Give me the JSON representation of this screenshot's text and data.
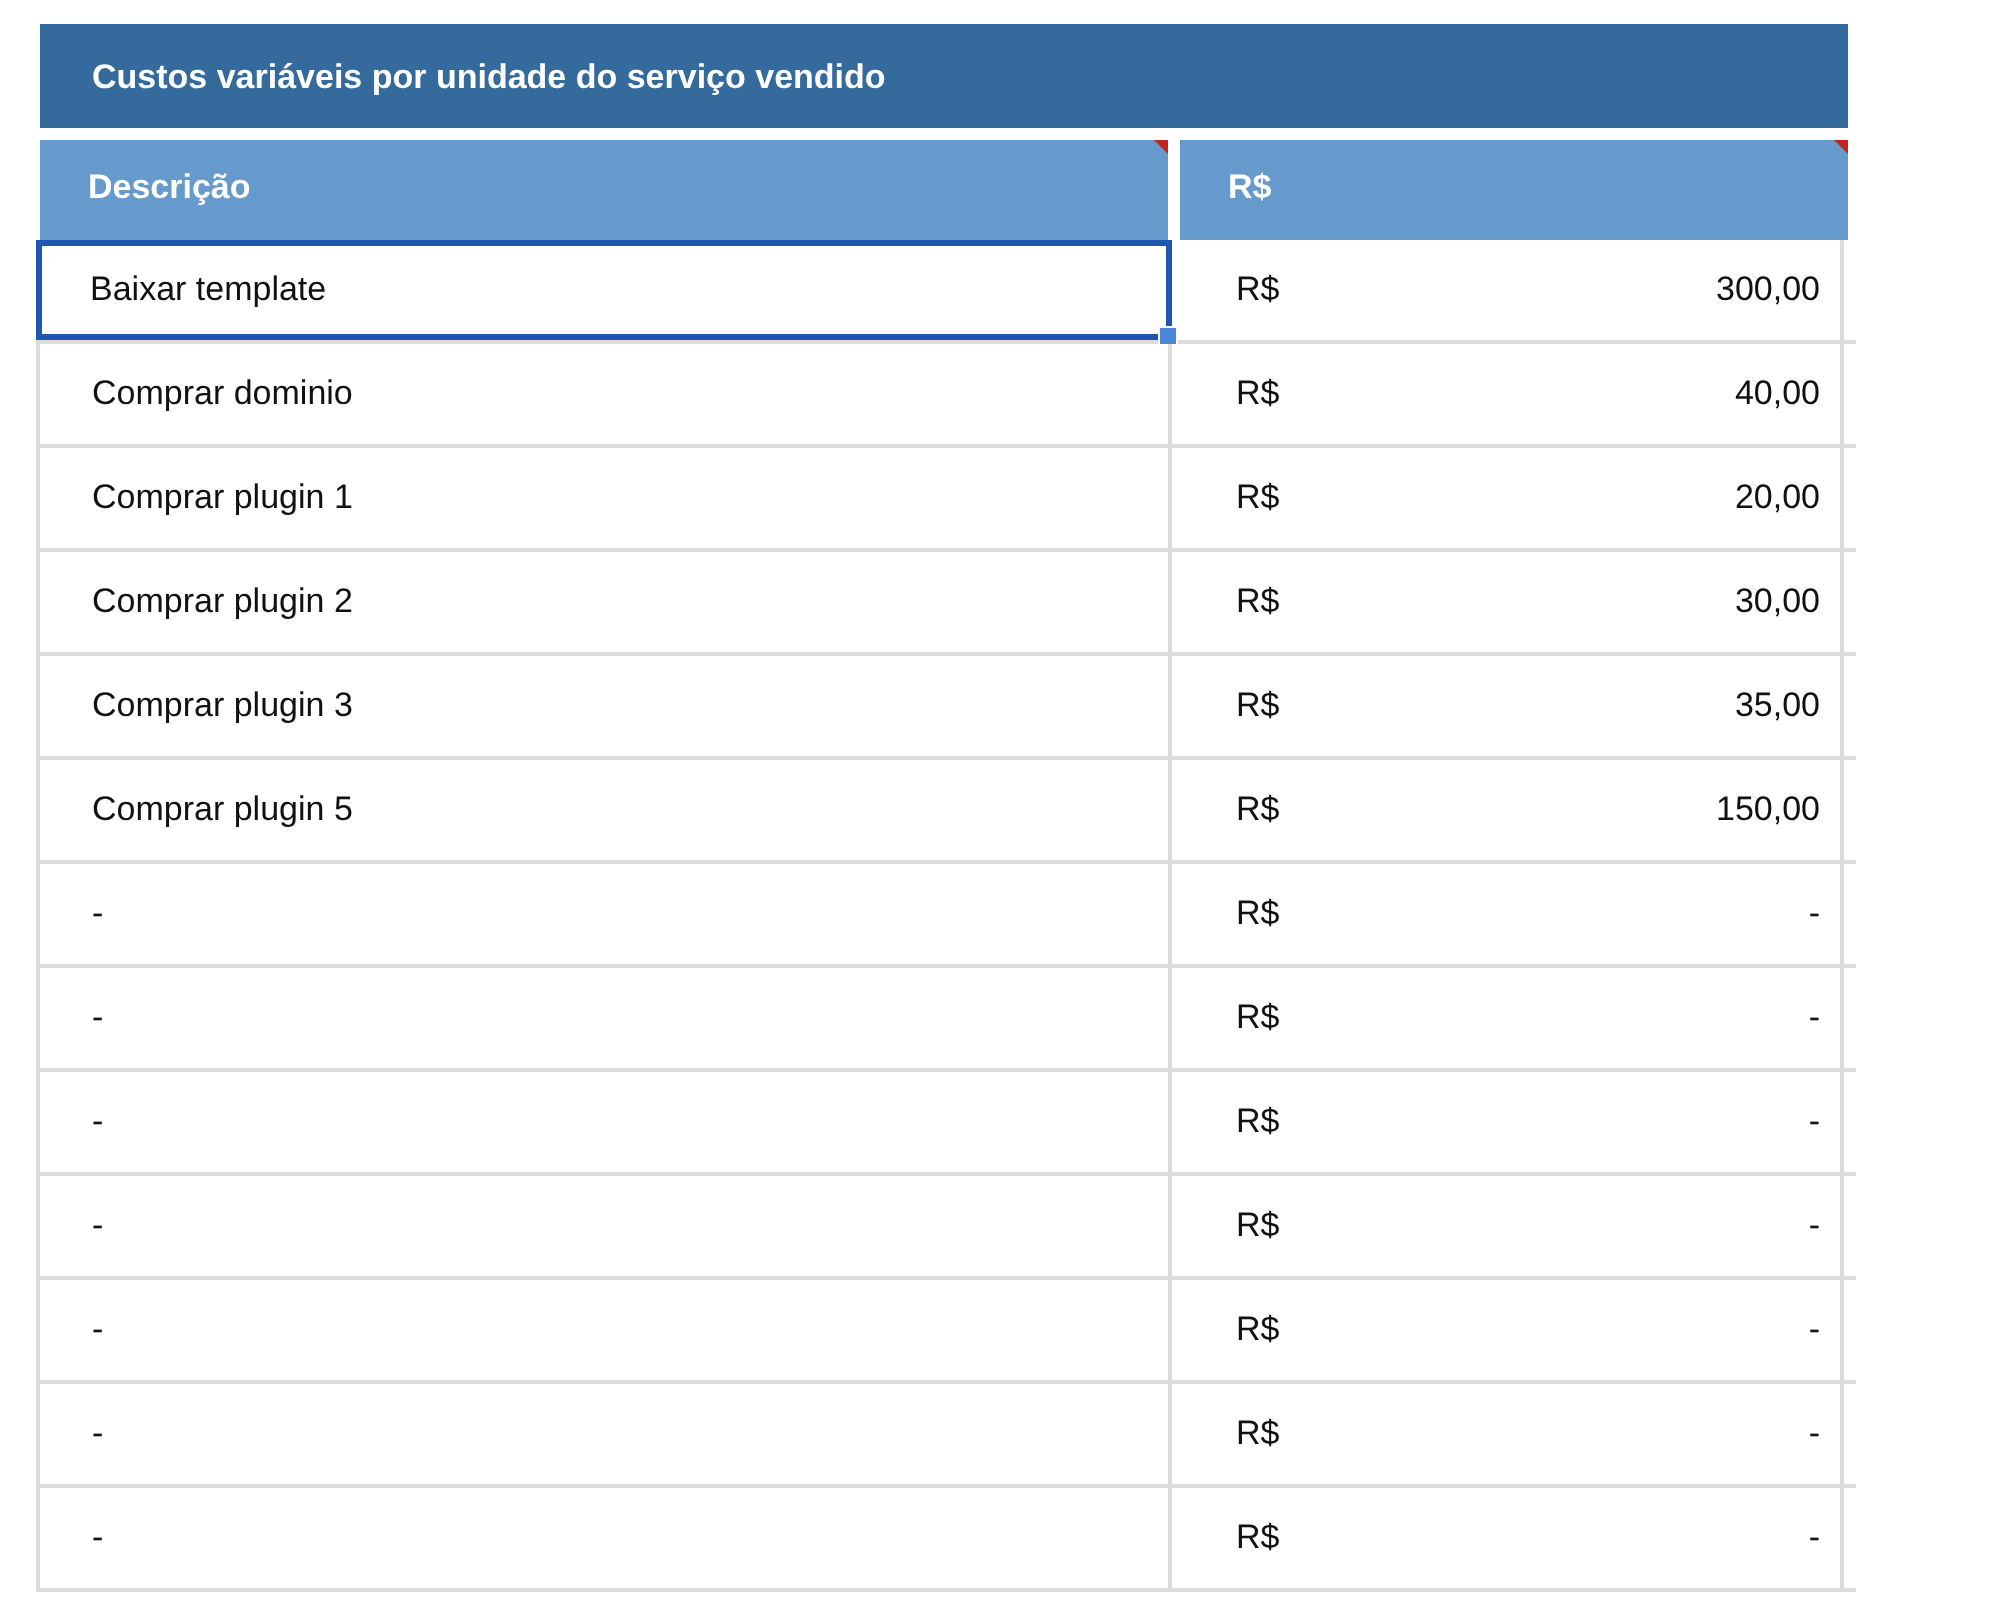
{
  "title": "Custos variáveis por unidade do serviço vendido",
  "columns": [
    {
      "label": "Descrição",
      "has_comment": true
    },
    {
      "label": "R$",
      "has_comment": true
    }
  ],
  "rows": [
    {
      "description": "Baixar template",
      "currency": "R$",
      "value": "300,00",
      "selected": true
    },
    {
      "description": "Comprar dominio",
      "currency": "R$",
      "value": "40,00",
      "selected": false
    },
    {
      "description": "Comprar plugin 1",
      "currency": "R$",
      "value": "20,00",
      "selected": false
    },
    {
      "description": "Comprar plugin 2",
      "currency": "R$",
      "value": "30,00",
      "selected": false
    },
    {
      "description": "Comprar plugin 3",
      "currency": "R$",
      "value": "35,00",
      "selected": false
    },
    {
      "description": "Comprar plugin 5",
      "currency": "R$",
      "value": "150,00",
      "selected": false
    },
    {
      "description": "-",
      "currency": "R$",
      "value": "-",
      "selected": false
    },
    {
      "description": "-",
      "currency": "R$",
      "value": "-",
      "selected": false
    },
    {
      "description": "-",
      "currency": "R$",
      "value": "-",
      "selected": false
    },
    {
      "description": "-",
      "currency": "R$",
      "value": "-",
      "selected": false
    },
    {
      "description": "-",
      "currency": "R$",
      "value": "-",
      "selected": false
    },
    {
      "description": "-",
      "currency": "R$",
      "value": "-",
      "selected": false
    },
    {
      "description": "-",
      "currency": "R$",
      "value": "-",
      "selected": false
    }
  ]
}
